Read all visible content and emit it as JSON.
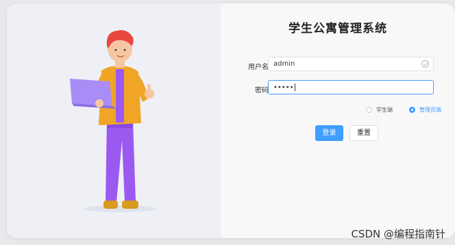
{
  "app": {
    "title": "学生公寓管理系统"
  },
  "form": {
    "username_label": "用户名",
    "username_value": "admin",
    "password_label": "密码",
    "password_value": "•••••"
  },
  "role": {
    "options": [
      "学生端",
      "管理员端"
    ],
    "selected": "管理员端"
  },
  "buttons": {
    "login": "登录",
    "reset": "重置"
  },
  "watermark": "CSDN @编程指南针",
  "colors": {
    "accent": "#409eff",
    "hair": "#e8473f",
    "shirt": "#f0a527",
    "pants": "#9b59f0",
    "laptop": "#a98cf5"
  }
}
